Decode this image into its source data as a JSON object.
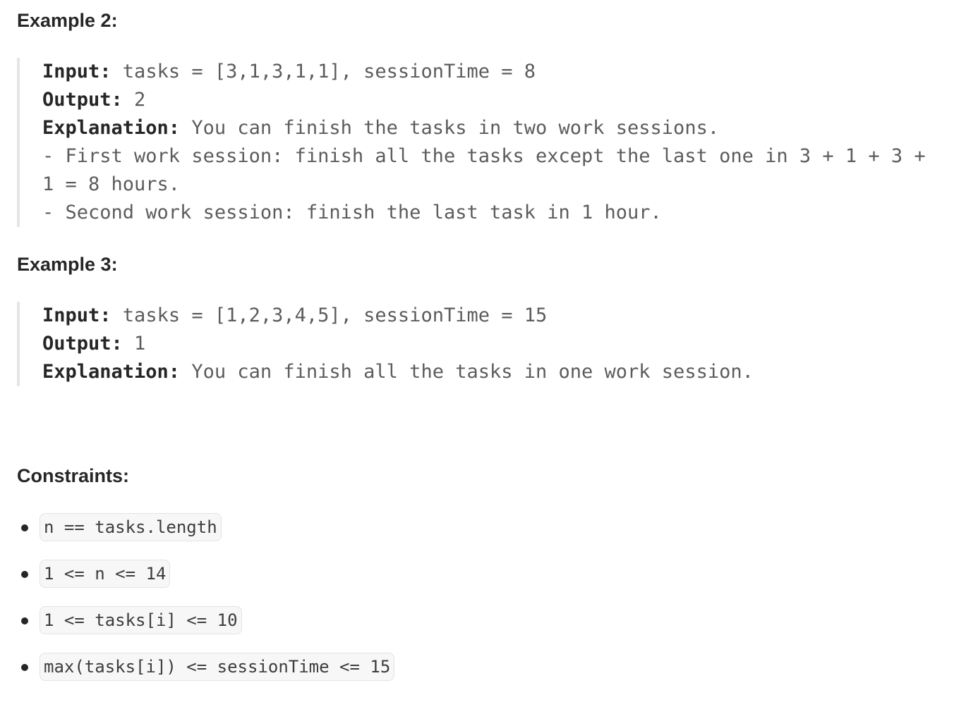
{
  "example2": {
    "heading": "Example 2:",
    "lines": [
      {
        "key": "Input:",
        "value": " tasks = [3,1,3,1,1], sessionTime = 8"
      },
      {
        "key": "Output:",
        "value": " 2"
      },
      {
        "key": "Explanation:",
        "value": " You can finish the tasks in two work sessions."
      },
      {
        "key": "",
        "value": "- First work session: finish all the tasks except the last one in 3 + 1 + 3 +"
      },
      {
        "key": "",
        "value": "1 = 8 hours."
      },
      {
        "key": "",
        "value": "- Second work session: finish the last task in 1 hour."
      }
    ]
  },
  "example3": {
    "heading": "Example 3:",
    "lines": [
      {
        "key": "Input:",
        "value": " tasks = [1,2,3,4,5], sessionTime = 15"
      },
      {
        "key": "Output:",
        "value": " 1"
      },
      {
        "key": "Explanation:",
        "value": " You can finish all the tasks in one work session."
      }
    ]
  },
  "constraints": {
    "heading": "Constraints:",
    "items": [
      "n == tasks.length",
      "1 <= n <= 14",
      "1 <= tasks[i] <= 10",
      "max(tasks[i]) <= sessionTime <= 15"
    ]
  }
}
